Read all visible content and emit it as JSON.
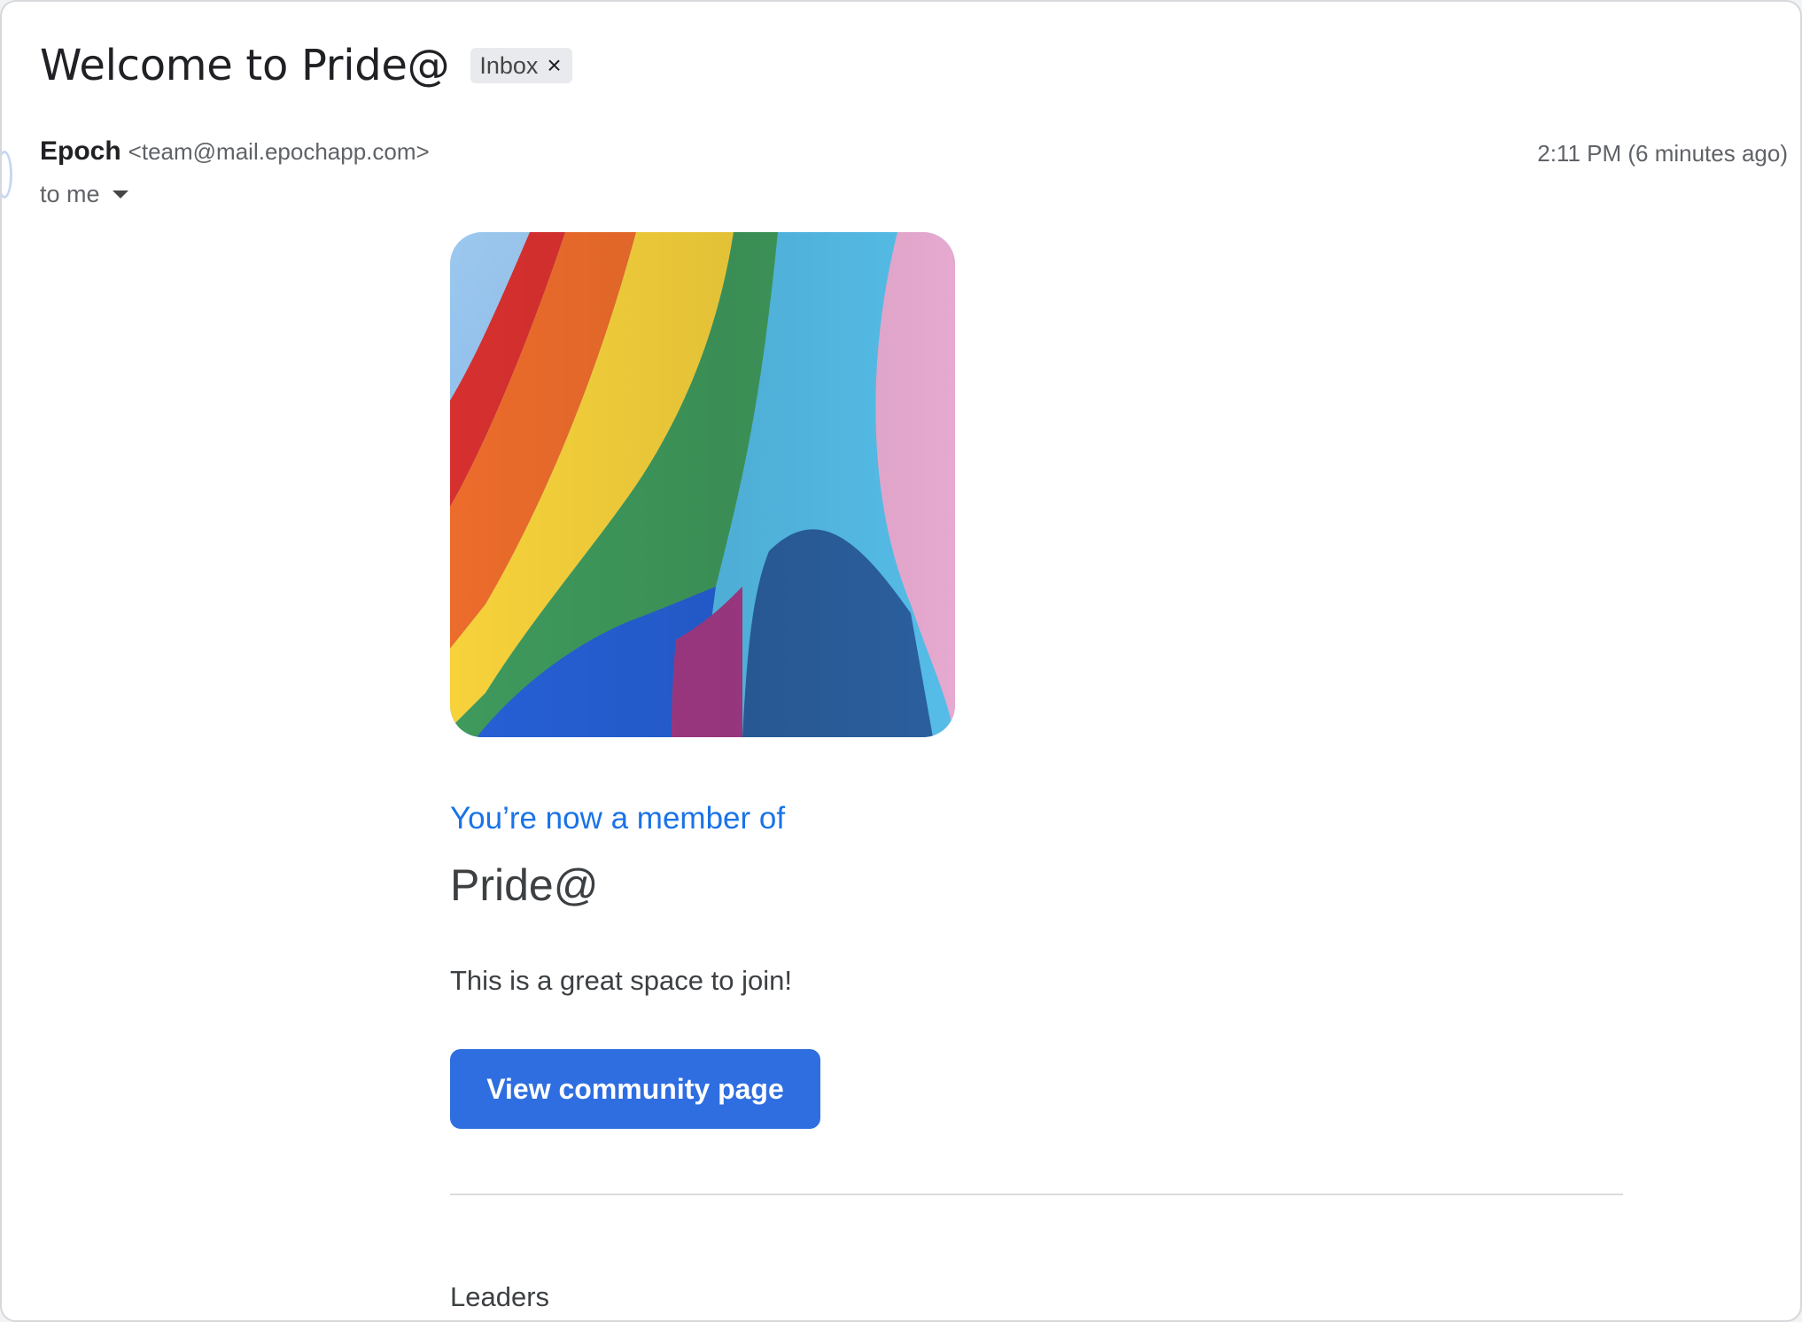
{
  "email": {
    "subject": "Welcome to Pride@",
    "label": "Inbox",
    "label_remove": "×",
    "sender_name": "Epoch",
    "sender_email": "<team@mail.epochapp.com>",
    "timestamp": "2:11 PM (6 minutes ago)",
    "recipient": "to me"
  },
  "body": {
    "hero_image": "rainbow-pride-flag-photo",
    "member_line": "You’re now a member of",
    "community_name": "Pride@",
    "description": "This is a great space to join!",
    "cta_label": "View community page",
    "section_title": "Leaders"
  },
  "colors": {
    "link_blue": "#1a73e8",
    "button_blue": "#2f6ee0"
  }
}
